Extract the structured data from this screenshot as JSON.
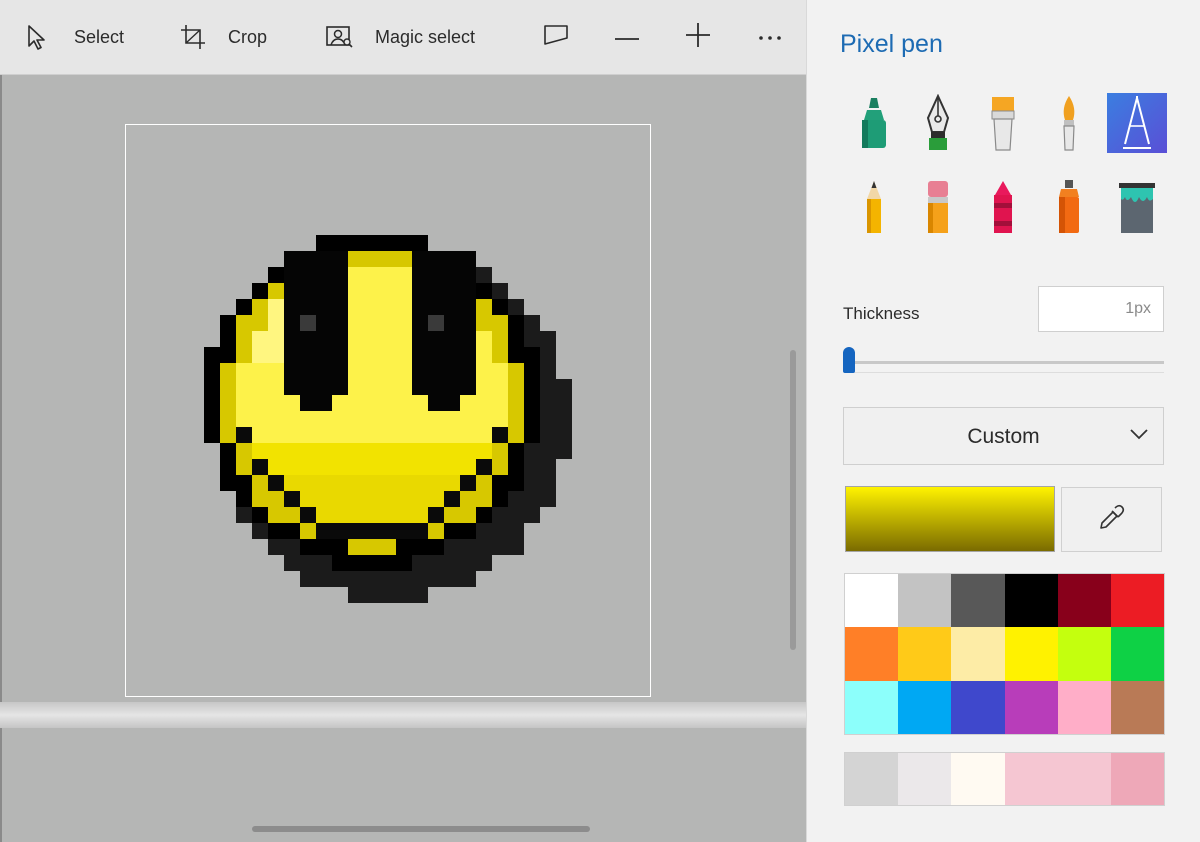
{
  "toolbar": {
    "select_label": "Select",
    "crop_label": "Crop",
    "magic_select_label": "Magic select"
  },
  "panel": {
    "title": "Pixel pen",
    "brushes": [
      {
        "name": "marker",
        "selected": false
      },
      {
        "name": "calligraphy pen",
        "selected": false
      },
      {
        "name": "oil brush",
        "selected": false
      },
      {
        "name": "watercolor",
        "selected": false
      },
      {
        "name": "pixel pen",
        "selected": true
      },
      {
        "name": "pencil",
        "selected": false
      },
      {
        "name": "eraser",
        "selected": false
      },
      {
        "name": "crayon",
        "selected": false
      },
      {
        "name": "spray can",
        "selected": false
      },
      {
        "name": "fill",
        "selected": false
      }
    ],
    "thickness_label": "Thickness",
    "thickness_value": "1px",
    "thickness_slider_fraction": 0.0,
    "color_mode": "Custom",
    "current_color_gradient": [
      "#fff300",
      "#7a6b00"
    ],
    "palette": [
      "#ffffff",
      "#c3c3c3",
      "#585858",
      "#000000",
      "#88001b",
      "#ec1c24",
      "#ff7f27",
      "#ffca18",
      "#fdeca6",
      "#fff200",
      "#c4ff0e",
      "#0ed145",
      "#8cfffb",
      "#00a8f3",
      "#3f48cc",
      "#b83dba",
      "#ffaec8",
      "#b97a56"
    ],
    "recent_colors": [
      "#d4d4d4",
      "#ebe8ea",
      "#fffaf2",
      "#f5c6d2",
      "#f5c6d2",
      "#eea8b8"
    ]
  },
  "colors": {
    "accent": "#1565c0",
    "title_blue": "#1d6bb3"
  }
}
